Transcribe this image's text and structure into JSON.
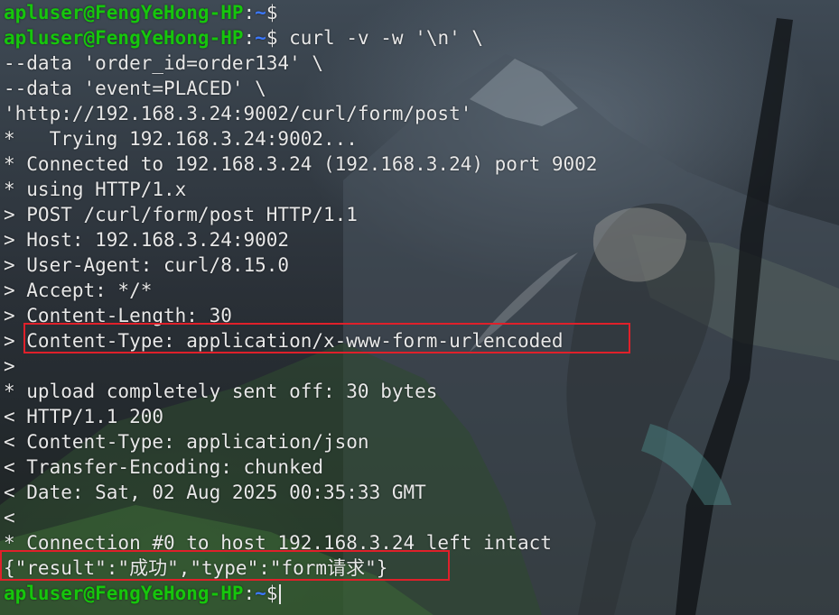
{
  "terminal": {
    "prompt_user": "apluser@FengYeHong-HP",
    "prompt_colon": ":",
    "prompt_path": "~",
    "prompt_dollar": "$",
    "command": " curl -v -w '\\n' \\",
    "lines": [
      "--data 'order_id=order134' \\",
      "--data 'event=PLACED' \\",
      "'http://192.168.3.24:9002/curl/form/post'",
      "*   Trying 192.168.3.24:9002...",
      "* Connected to 192.168.3.24 (192.168.3.24) port 9002",
      "* using HTTP/1.x",
      "> POST /curl/form/post HTTP/1.1",
      "> Host: 192.168.3.24:9002",
      "> User-Agent: curl/8.15.0",
      "> Accept: */*",
      "> Content-Length: 30",
      "> Content-Type: application/x-www-form-urlencoded",
      ">",
      "* upload completely sent off: 30 bytes",
      "< HTTP/1.1 200",
      "< Content-Type: application/json",
      "< Transfer-Encoding: chunked",
      "< Date: Sat, 02 Aug 2025 00:35:33 GMT",
      "<",
      "* Connection #0 to host 192.168.3.24 left intact",
      "{\"result\":\"成功\",\"type\":\"form请求\"}"
    ]
  },
  "colors": {
    "prompt_user": "#16c60c",
    "prompt_path": "#3b78ff",
    "text": "#e8e8e8",
    "highlight_box": "#e0202a"
  }
}
